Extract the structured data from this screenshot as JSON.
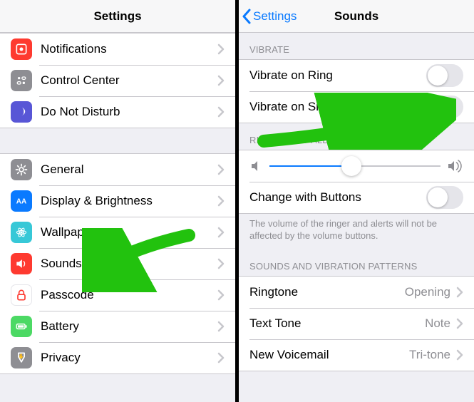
{
  "left": {
    "title": "Settings",
    "group1": [
      {
        "icon": "notifications-icon",
        "bg": "bg-notif",
        "label": "Notifications"
      },
      {
        "icon": "control-center-icon",
        "bg": "bg-cc",
        "label": "Control Center"
      },
      {
        "icon": "do-not-disturb-icon",
        "bg": "bg-dnd",
        "label": "Do Not Disturb"
      }
    ],
    "group2": [
      {
        "icon": "general-icon",
        "bg": "bg-general",
        "label": "General"
      },
      {
        "icon": "display-icon",
        "bg": "bg-display",
        "label": "Display & Brightness"
      },
      {
        "icon": "wallpaper-icon",
        "bg": "bg-wall",
        "label": "Wallpaper"
      },
      {
        "icon": "sounds-icon",
        "bg": "bg-sounds",
        "label": "Sounds"
      },
      {
        "icon": "passcode-icon",
        "bg": "bg-passlock",
        "label": "Passcode"
      },
      {
        "icon": "battery-icon",
        "bg": "bg-battery",
        "label": "Battery"
      },
      {
        "icon": "privacy-icon",
        "bg": "bg-privacy",
        "label": "Privacy"
      }
    ]
  },
  "right": {
    "title": "Sounds",
    "back_label": "Settings",
    "section_vibrate_header": "VIBRATE",
    "vibrate_on_ring": {
      "label": "Vibrate on Ring",
      "on": false
    },
    "vibrate_on_silent": {
      "label": "Vibrate on Silent",
      "on": false
    },
    "section_ringer_header": "RINGER AND ALERTS",
    "volume_slider": {
      "value": 0.48
    },
    "change_with_buttons": {
      "label": "Change with Buttons",
      "on": false
    },
    "ringer_footer": "The volume of the ringer and alerts will not be affected by the volume buttons.",
    "section_patterns_header": "SOUNDS AND VIBRATION PATTERNS",
    "patterns": [
      {
        "label": "Ringtone",
        "value": "Opening"
      },
      {
        "label": "Text Tone",
        "value": "Note"
      },
      {
        "label": "New Voicemail",
        "value": "Tri-tone"
      }
    ]
  },
  "colors": {
    "accent": "#0a7aff",
    "annotation": "#22c20e"
  }
}
